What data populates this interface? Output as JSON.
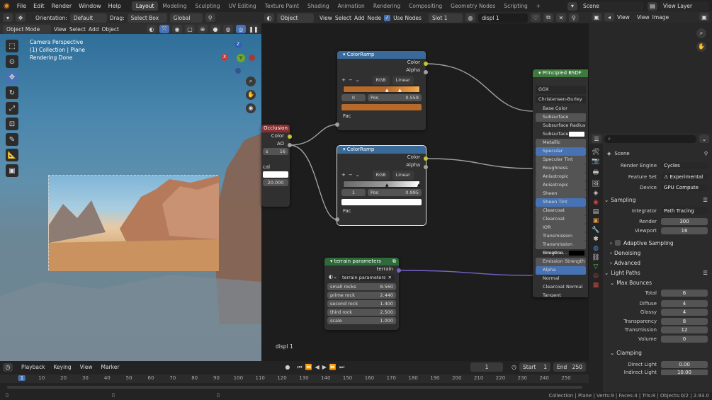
{
  "topbar": {
    "menus": [
      "File",
      "Edit",
      "Render",
      "Window",
      "Help"
    ],
    "workspaces": [
      "Layout",
      "Modeling",
      "Sculpting",
      "UV Editing",
      "Texture Paint",
      "Shading",
      "Animation",
      "Rendering",
      "Compositing",
      "Geometry Nodes",
      "Scripting"
    ],
    "active_workspace": "Layout",
    "add_tab": "+",
    "scene": "Scene",
    "view_layer": "View Layer"
  },
  "viewport_header": {
    "orientation_label": "Orientation:",
    "orientation_value": "Default",
    "drag_label": "Drag:",
    "drag_value": "Select Box",
    "transform_space": "Global",
    "mode": "Object Mode",
    "menus": [
      "View",
      "Select",
      "Add",
      "Object"
    ]
  },
  "viewport_info": {
    "line1": "Camera Perspective",
    "line2": "(1) Collection | Plane",
    "line3": "Rendering Done"
  },
  "gizmo": {
    "x": "X",
    "y": "Y",
    "z": "Z"
  },
  "node_header": {
    "type": "Object",
    "menus": [
      "View",
      "Select",
      "Add",
      "Node"
    ],
    "use_nodes_label": "Use Nodes",
    "slot": "Slot 1",
    "material": "displ 1"
  },
  "node_editor": {
    "material_label": "displ 1"
  },
  "occlusion_node": {
    "title": "Occlusion",
    "outputs": [
      "Color",
      "AO"
    ],
    "samples": "16",
    "samples_prefix": "s",
    "cal_label": "cal",
    "distance": "20.000"
  },
  "colorramp1": {
    "title": "ColorRamp",
    "outputs": [
      "Color",
      "Alpha"
    ],
    "mode": "RGB",
    "interp": "Linear",
    "index": "0",
    "pos_label": "Pos",
    "pos": "0.559",
    "input": "Fac",
    "swatch": "#b86a2a"
  },
  "colorramp2": {
    "title": "ColorRamp",
    "outputs": [
      "Color",
      "Alpha"
    ],
    "mode": "RGB",
    "interp": "Linear",
    "index": "1",
    "pos_label": "Pos",
    "pos": "0.995",
    "input": "Fac",
    "swatch": "#ffffff"
  },
  "terrain_node": {
    "title": "terrain parameters",
    "output": "terrain",
    "group": "terrain parameters",
    "params": [
      {
        "label": "small rocks",
        "value": "8.560"
      },
      {
        "label": "prime rock",
        "value": "2.440"
      },
      {
        "label": "second rock",
        "value": "1.400"
      },
      {
        "label": "third rock",
        "value": "2.500"
      },
      {
        "label": "scale",
        "value": "1.000"
      }
    ]
  },
  "bsdf_node": {
    "title": "Principled BSDF",
    "distribution": "GGX",
    "subsurface_method": "Christensen-Burley",
    "inputs": [
      "Base Color",
      "Subsurface",
      "Subsurface Radius",
      "Subsurface C...",
      "Metallic",
      "Specular",
      "Specular Tint",
      "Roughness",
      "Anisotropic",
      "Anisotropic Rotation",
      "Sheen",
      "Sheen Tint",
      "Clearcoat",
      "Clearcoat Roughness",
      "IOR",
      "Transmission",
      "Transmission Roughne...",
      "Emission",
      "Emission Strength",
      "Alpha",
      "Normal",
      "Clearcoat Normal",
      "Tangent"
    ]
  },
  "outliner_header": {
    "menus": [
      "View",
      "View",
      "Image"
    ]
  },
  "properties": {
    "scene_label": "Scene",
    "render_engine_label": "Render Engine",
    "render_engine": "Cycles",
    "feature_set_label": "Feature Set",
    "feature_set": "Experimental",
    "device_label": "Device",
    "device": "GPU Compute",
    "sampling": "Sampling",
    "integrator_label": "Integrator",
    "integrator": "Path Tracing",
    "render_label": "Render",
    "render": "300",
    "viewport_label": "Viewport",
    "viewport": "16",
    "adaptive": "Adaptive Sampling",
    "denoising": "Denoising",
    "advanced": "Advanced",
    "light_paths": "Light Paths",
    "max_bounces": "Max Bounces",
    "total_label": "Total",
    "total": "6",
    "diffuse_label": "Diffuse",
    "diffuse": "4",
    "glossy_label": "Glossy",
    "glossy": "4",
    "transparency_label": "Transparency",
    "transparency": "8",
    "transmission_label": "Transmission",
    "transmission": "12",
    "volume_label": "Volume",
    "volume": "0",
    "clamping": "Clamping",
    "direct_label": "Direct Light",
    "direct": "0.00",
    "indirect_label": "Indirect Light",
    "indirect": "10.00"
  },
  "timeline": {
    "menus": [
      "Playback",
      "Keying",
      "View",
      "Marker"
    ],
    "current_frame": "1",
    "start_label": "Start",
    "start": "1",
    "end_label": "End",
    "end": "250",
    "ticks": [
      "1",
      "10",
      "20",
      "30",
      "40",
      "50",
      "60",
      "70",
      "80",
      "90",
      "100",
      "110",
      "120",
      "130",
      "140",
      "150",
      "160",
      "170",
      "180",
      "190",
      "200",
      "210",
      "220",
      "230",
      "240",
      "250"
    ]
  },
  "status": "Collection | Plane | Verts:9 | Faces:4 | Tris:8 | Objects:0/2 | 2.93.0"
}
